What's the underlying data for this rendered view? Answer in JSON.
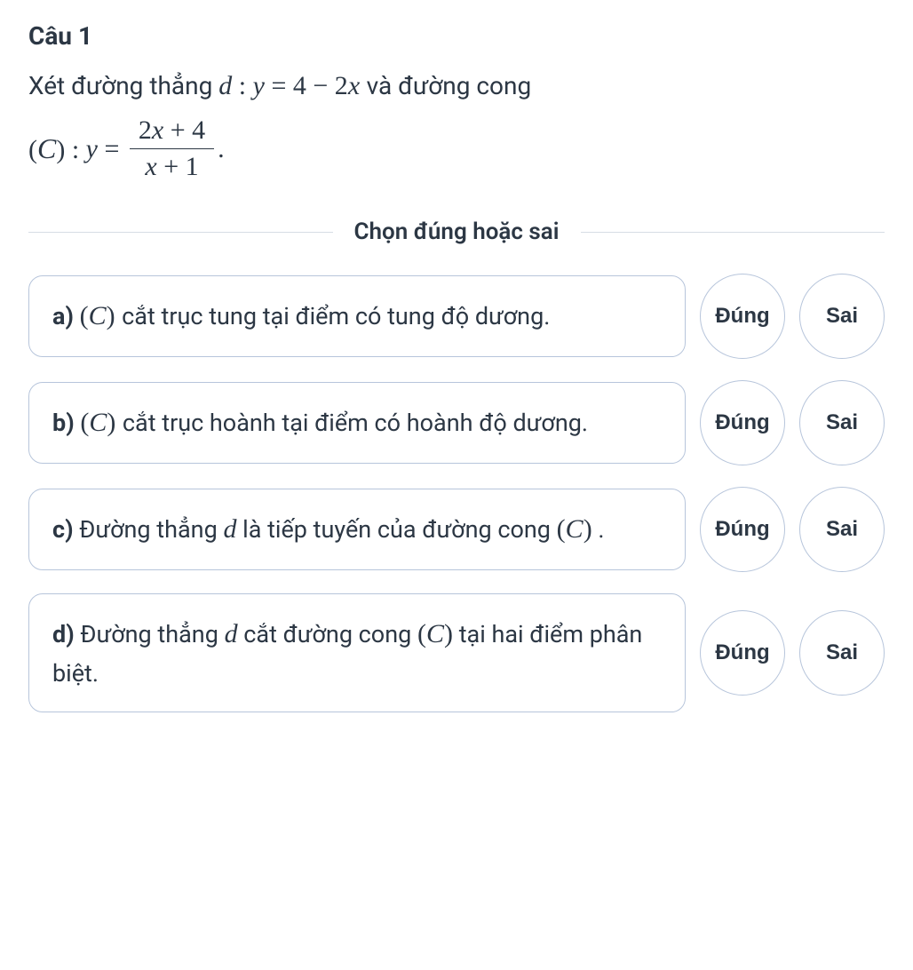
{
  "question": {
    "title": "Câu 1",
    "prompt_prefix": "Xét đường thẳng ",
    "line_d": "d : y = 4 − 2x",
    "prompt_mid": " và đường cong",
    "curve_label": "(C) : y = ",
    "frac_num": "2x + 4",
    "frac_den": "x + 1",
    "period": "."
  },
  "instruction": "Chọn đúng hoặc sai",
  "buttons": {
    "true": "Đúng",
    "false": "Sai"
  },
  "options": [
    {
      "label": "a)",
      "text_pre": " ",
      "math": "(C)",
      "text_post": " cắt trục tung tại điểm có tung độ dương."
    },
    {
      "label": "b)",
      "text_pre": " ",
      "math": "(C)",
      "text_post": " cắt trục hoành tại điểm có hoành độ dương."
    },
    {
      "label": "c)",
      "text_pre": " Đường thẳng ",
      "math": "d",
      "text_post": " là tiếp tuyến của đường cong ",
      "math2": "(C)",
      "text_end": "."
    },
    {
      "label": "d)",
      "text_pre": " Đường thẳng ",
      "math": "d",
      "text_post": " cắt đường cong ",
      "math2": "(C)",
      "text_end": " tại hai điểm phân biệt."
    }
  ]
}
